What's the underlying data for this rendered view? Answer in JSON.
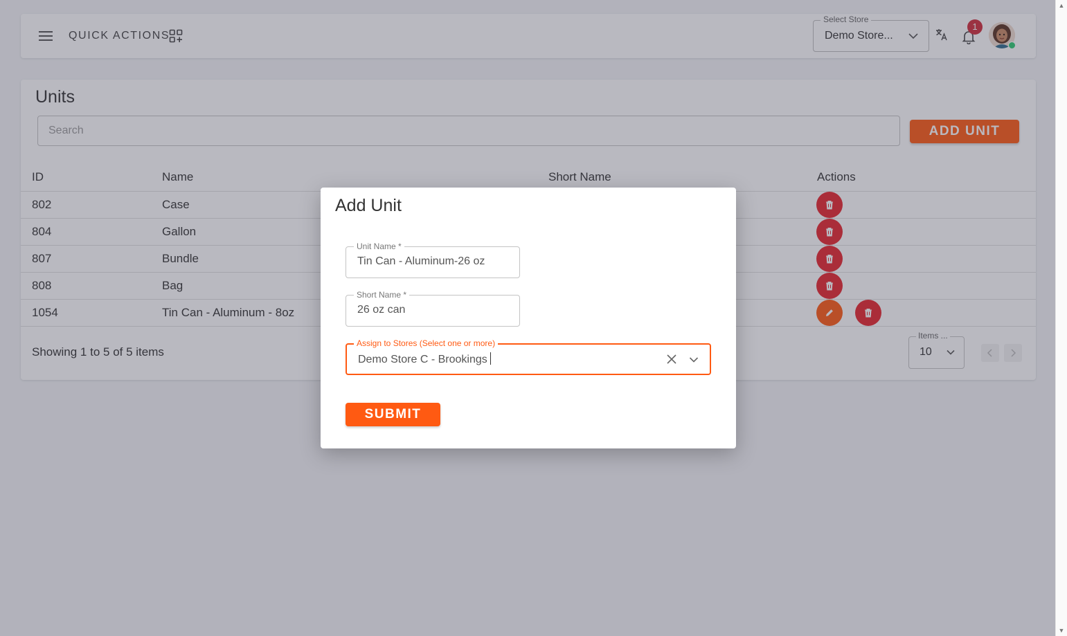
{
  "header": {
    "quick_actions_label": "QUICK ACTIONS",
    "store_select_legend": "Select Store",
    "store_select_value": "Demo Store...",
    "notification_count": "1"
  },
  "units": {
    "title": "Units",
    "search_placeholder": "Search",
    "add_button": "ADD UNIT",
    "columns": {
      "id": "ID",
      "name": "Name",
      "short_name": "Short Name",
      "actions": "Actions"
    },
    "rows": [
      {
        "id": "802",
        "name": "Case"
      },
      {
        "id": "804",
        "name": "Gallon"
      },
      {
        "id": "807",
        "name": "Bundle"
      },
      {
        "id": "808",
        "name": "Bag"
      },
      {
        "id": "1054",
        "name": "Tin Can - Aluminum - 8oz"
      }
    ],
    "footer": "Showing 1 to 5 of 5 items",
    "items_legend": "Items ...",
    "items_value": "10"
  },
  "modal": {
    "title": "Add Unit",
    "unit_name_legend": "Unit Name *",
    "unit_name_value": "Tin Can - Aluminum-26 oz",
    "short_name_legend": "Short Name *",
    "short_name_value": "26 oz can",
    "stores_legend": "Assign to Stores (Select one or more)",
    "stores_value": "Demo Store C - Brookings",
    "submit": "SUBMIT"
  },
  "colors": {
    "primary": "#ff5a12",
    "danger": "#e8252d",
    "badge": "#d12d3b",
    "online": "#2ecc71"
  },
  "icons": [
    "menu-icon",
    "quick-actions-grid-icon",
    "chevron-down-icon",
    "translate-icon",
    "bell-icon",
    "trash-icon",
    "pencil-icon",
    "close-icon",
    "chevron-left-icon",
    "chevron-right-icon"
  ]
}
